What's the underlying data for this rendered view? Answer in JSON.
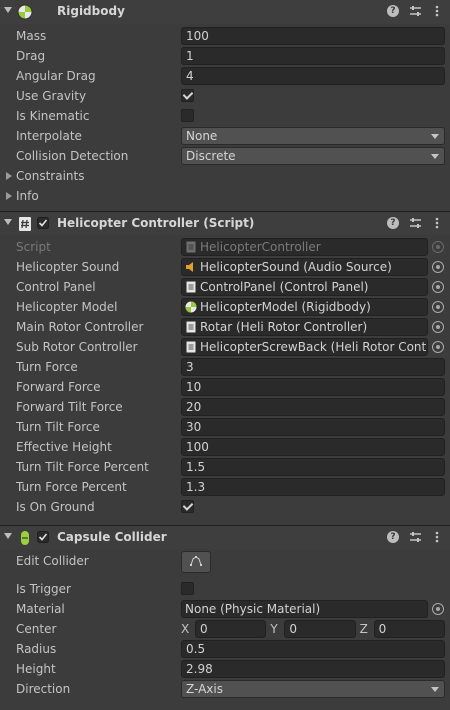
{
  "rigidbody": {
    "title": "Rigidbody",
    "mass_label": "Mass",
    "mass": "100",
    "drag_label": "Drag",
    "drag": "1",
    "angular_drag_label": "Angular Drag",
    "angular_drag": "4",
    "use_gravity_label": "Use Gravity",
    "use_gravity": true,
    "is_kinematic_label": "Is Kinematic",
    "is_kinematic": false,
    "interpolate_label": "Interpolate",
    "interpolate": "None",
    "collision_label": "Collision Detection",
    "collision": "Discrete",
    "constraints_label": "Constraints",
    "info_label": "Info"
  },
  "script": {
    "title": "Helicopter Controller (Script)",
    "script_label": "Script",
    "script_value": "HelicopterController",
    "sound_label": "Helicopter Sound",
    "sound_value": "HelicopterSound (Audio Source)",
    "panel_label": "Control Panel",
    "panel_value": "ControlPanel (Control Panel)",
    "model_label": "Helicopter Model",
    "model_value": "HelicopterModel (Rigidbody)",
    "main_rotor_label": "Main Rotor Controller",
    "main_rotor_value": "Rotar (Heli Rotor Controller)",
    "sub_rotor_label": "Sub Rotor Controller",
    "sub_rotor_value": "HelicopterScrewBack (Heli Rotor Contro",
    "turn_force_label": "Turn Force",
    "turn_force": "3",
    "forward_force_label": "Forward Force",
    "forward_force": "10",
    "forward_tilt_label": "Forward Tilt Force",
    "forward_tilt": "20",
    "turn_tilt_label": "Turn Tilt Force",
    "turn_tilt": "30",
    "eff_height_label": "Effective Height",
    "eff_height": "100",
    "turn_tilt_pct_label": "Turn Tilt Force Percent",
    "turn_tilt_pct": "1.5",
    "turn_force_pct_label": "Turn Force Percent",
    "turn_force_pct": "1.3",
    "on_ground_label": "Is On Ground",
    "on_ground": true
  },
  "capsule": {
    "title": "Capsule Collider",
    "edit_label": "Edit Collider",
    "trigger_label": "Is Trigger",
    "trigger": false,
    "material_label": "Material",
    "material_value": "None (Physic Material)",
    "center_label": "Center",
    "center": {
      "x_label": "X",
      "x": "0",
      "y_label": "Y",
      "y": "0",
      "z_label": "Z",
      "z": "0"
    },
    "radius_label": "Radius",
    "radius": "0.5",
    "height_label": "Height",
    "height": "2.98",
    "direction_label": "Direction",
    "direction": "Z-Axis"
  },
  "icons": {
    "rigidbody": "rigidbody-icon",
    "script": "script-hash-icon",
    "capsule": "capsule-collider-icon",
    "help": "help-icon",
    "preset": "preset-sliders-icon",
    "menu": "kebab-menu-icon"
  },
  "colors": {
    "background": "#3c3c3c",
    "header": "#3e3e3e",
    "field": "#2a2a2a",
    "dropdown": "#515151",
    "capsule_green": "#9ad03a"
  }
}
